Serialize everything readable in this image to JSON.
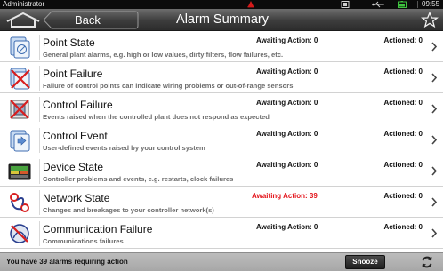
{
  "status_bar": {
    "user": "Administrator",
    "time": "09:55",
    "icons": [
      "alarm-icon",
      "sd-card-icon",
      "usb-icon",
      "battery-icon"
    ]
  },
  "header": {
    "home_icon": "home-icon",
    "back_label": "Back",
    "title": "Alarm Summary",
    "star_icon": "star-icon"
  },
  "alarms": [
    {
      "name": "Point State",
      "description": "General plant alarms, e.g. high or low values, dirty filters, flow failures, etc.",
      "awaiting": "Awaiting Action: 0",
      "actioned": "Actioned: 0",
      "icon": "point-state-icon"
    },
    {
      "name": "Point Failure",
      "description": "Failure of control points can indicate wiring problems or out-of-range sensors",
      "awaiting": "Awaiting Action: 0",
      "actioned": "Actioned: 0",
      "icon": "point-failure-icon"
    },
    {
      "name": "Control Failure",
      "description": "Events raised when the controlled plant does not respond as expected",
      "awaiting": "Awaiting Action: 0",
      "actioned": "Actioned: 0",
      "icon": "control-failure-icon"
    },
    {
      "name": "Control Event",
      "description": "User-defined events raised by your control system",
      "awaiting": "Awaiting Action: 0",
      "actioned": "Actioned: 0",
      "icon": "control-event-icon"
    },
    {
      "name": "Device State",
      "description": "Controller problems and events, e.g. restarts, clock failures",
      "awaiting": "Awaiting Action: 0",
      "actioned": "Actioned: 0",
      "icon": "device-state-icon"
    },
    {
      "name": "Network State",
      "description": "Changes and breakages to your controller network(s)",
      "awaiting": "Awaiting Action: 39",
      "actioned": "Actioned: 0",
      "icon": "network-state-icon",
      "alert": true
    },
    {
      "name": "Communication Failure",
      "description": "Communications failures",
      "awaiting": "Awaiting Action: 0",
      "actioned": "Actioned: 0",
      "icon": "communication-failure-icon"
    }
  ],
  "colors": {
    "alert": "#e3151c",
    "header": "#3d3d3d",
    "footer": "#b3b3b3"
  },
  "footer": {
    "message": "You have 39 alarms requiring action",
    "snooze_label": "Snooze",
    "refresh_icon": "refresh-icon"
  }
}
